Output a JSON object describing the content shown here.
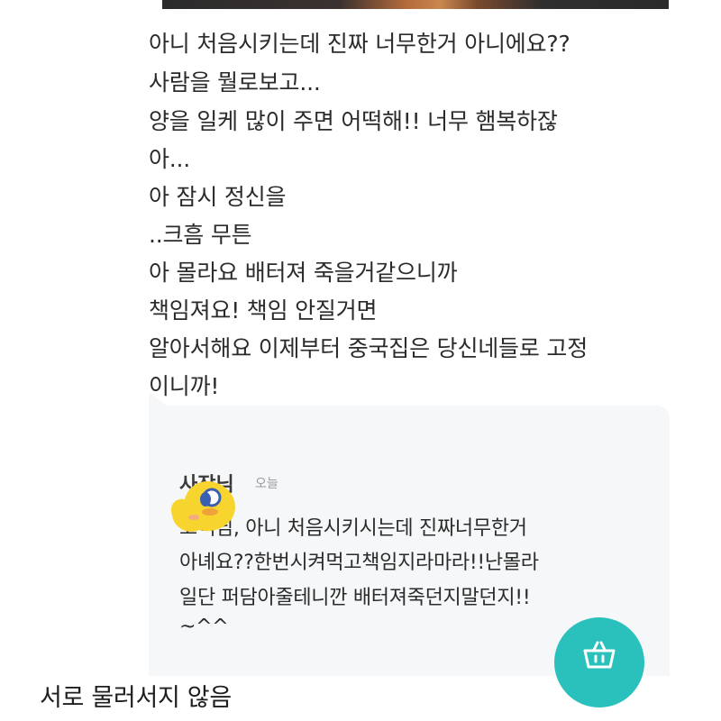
{
  "review": {
    "lines": [
      "아니 처음시키는데 진짜 너무한거 아니에요??",
      "사람을 뭘로보고...",
      "양을 일케 많이 주면 어떡해!! 너무 햄복하잖",
      "아...",
      "아 잠시 정신을",
      "..크흠 무튼",
      "아 몰라요 배터져 죽을거같으니까",
      "책임져요! 책임 안질거면",
      "알아서해요 이제부터 중국집은 당신네들로 고정",
      "이니까!"
    ]
  },
  "reply": {
    "author": "사장님",
    "time": "오늘",
    "lines": [
      "고객님, 아니 처음시키시는데 진짜너무한거",
      "아녜요??한번시켜먹고책임지라마라!!난몰라",
      "일단 퍼담아줄테니깐 배터져죽던지말던지!!",
      "~^^"
    ]
  },
  "fab": {
    "icon": "shopping-basket-icon",
    "color": "#2ac1bc"
  },
  "caption": "서로 물러서지 않음"
}
